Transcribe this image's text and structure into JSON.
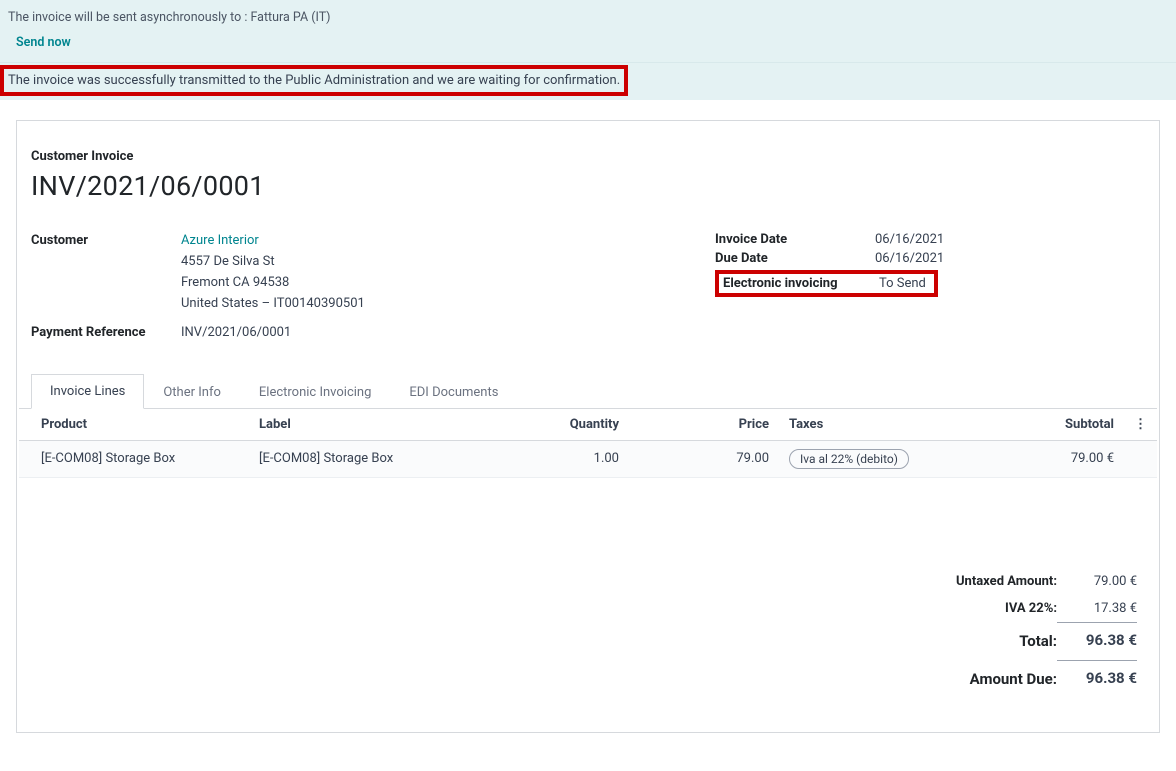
{
  "alert": {
    "async_msg": "The invoice will be sent asynchronously to : Fattura PA (IT)",
    "send_now": "Send now",
    "confirm_msg": "The invoice was successfully transmitted to the Public Administration and we are waiting for confirmation."
  },
  "header": {
    "title_label": "Customer Invoice",
    "number": "INV/2021/06/0001"
  },
  "fields": {
    "customer_label": "Customer",
    "customer_name": "Azure Interior",
    "addr_line1": "4557 De Silva St",
    "addr_line2": "Fremont CA 94538",
    "addr_line3": "United States – IT00140390501",
    "payref_label": "Payment Reference",
    "payref_val": "INV/2021/06/0001",
    "invoice_date_label": "Invoice Date",
    "invoice_date_val": "06/16/2021",
    "due_date_label": "Due Date",
    "due_date_val": "06/16/2021",
    "einv_label": "Electronic invoicing",
    "einv_val": "To Send"
  },
  "tabs": {
    "lines": "Invoice Lines",
    "other": "Other Info",
    "einv": "Electronic Invoicing",
    "edi": "EDI Documents"
  },
  "grid": {
    "cols": {
      "product": "Product",
      "label": "Label",
      "quantity": "Quantity",
      "price": "Price",
      "taxes": "Taxes",
      "subtotal": "Subtotal"
    },
    "rows": [
      {
        "product": "[E-COM08] Storage Box",
        "label": "[E-COM08] Storage Box",
        "quantity": "1.00",
        "price": "79.00",
        "tax": "Iva al 22% (debito)",
        "subtotal": "79.00 €"
      }
    ]
  },
  "totals": {
    "untaxed_label": "Untaxed Amount:",
    "untaxed_val": "79.00 €",
    "iva_label": "IVA 22%:",
    "iva_val": "17.38 €",
    "total_label": "Total:",
    "total_val": "96.38 €",
    "due_label": "Amount Due:",
    "due_val": "96.38 €"
  }
}
